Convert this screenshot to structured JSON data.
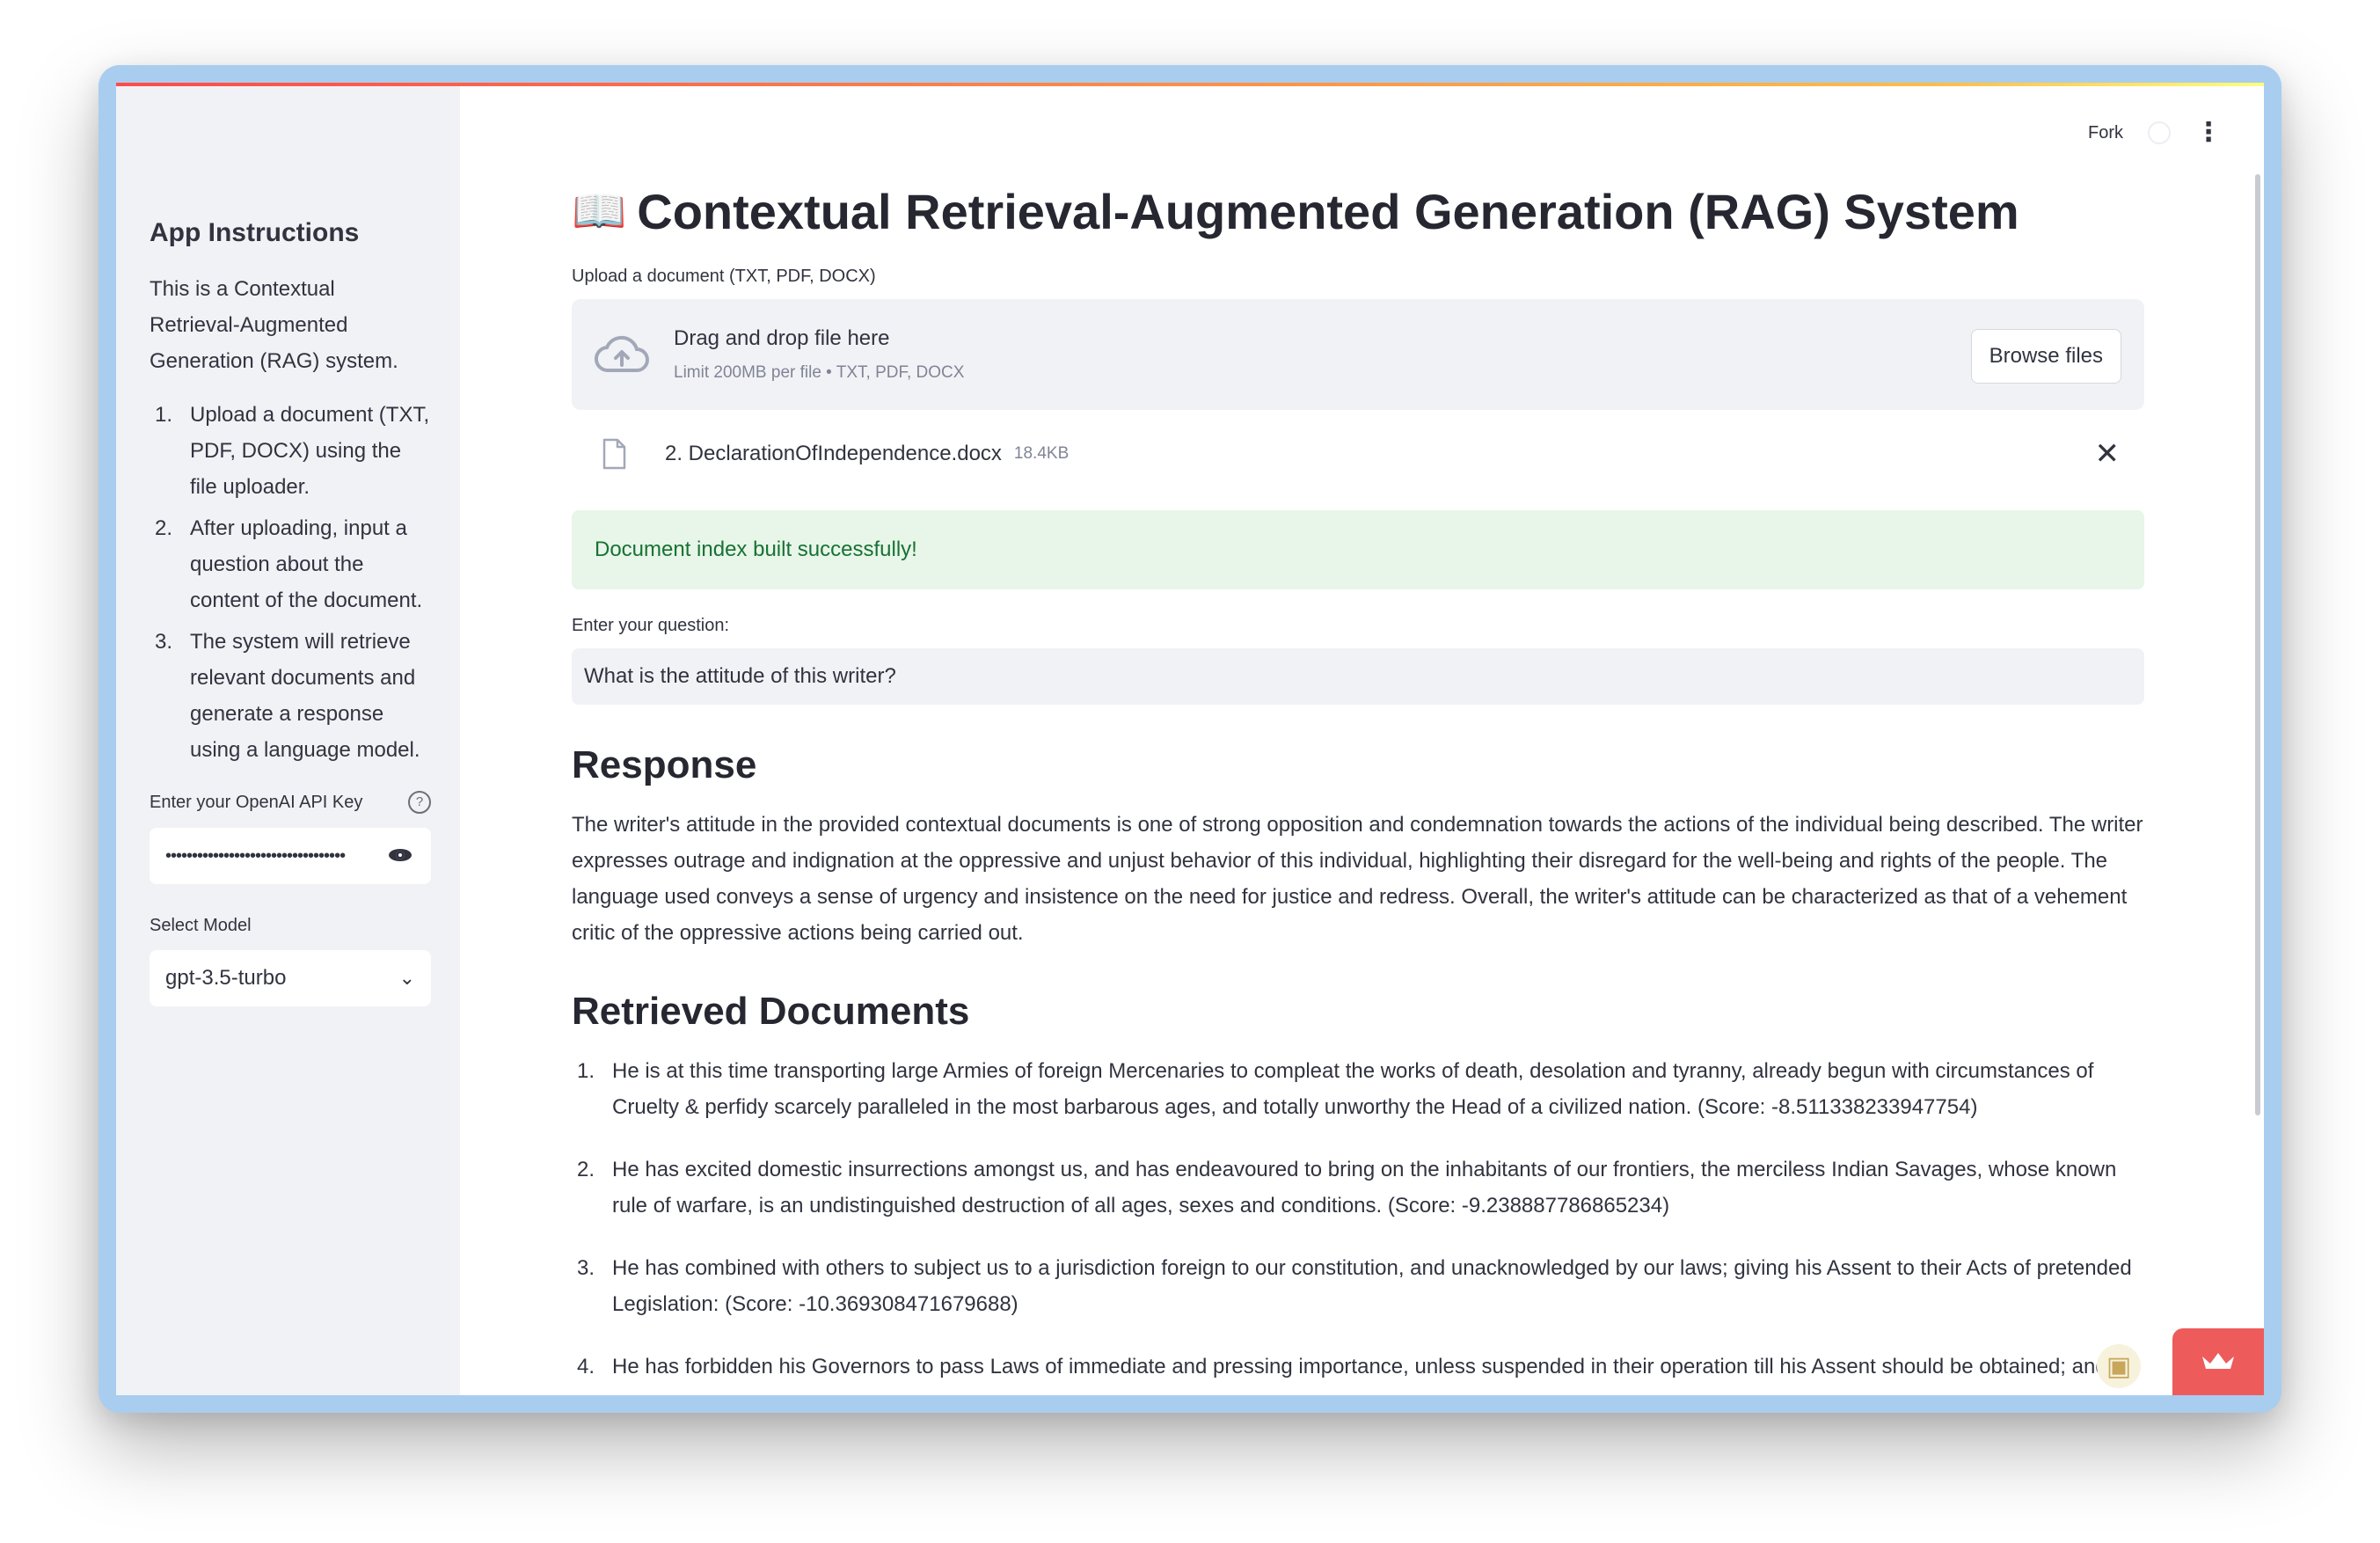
{
  "sidebar": {
    "title": "App Instructions",
    "intro": "This is a Contextual Retrieval-Augmented Generation (RAG) system.",
    "steps": [
      {
        "num": "1.",
        "text": "Upload a document (TXT, PDF, DOCX) using the file uploader."
      },
      {
        "num": "2.",
        "text": "After uploading, input a question about the content of the document."
      },
      {
        "num": "3.",
        "text": "The system will retrieve relevant documents and generate a response using a language model."
      }
    ],
    "api_key_label": "Enter your OpenAI API Key",
    "api_key_value": "••••••••••••••••••••••••••••••••••",
    "model_label": "Select Model",
    "model_value": "gpt-3.5-turbo"
  },
  "toolbar": {
    "fork_label": "Fork"
  },
  "main": {
    "title": "Contextual Retrieval-Augmented Generation (RAG) System",
    "upload_label": "Upload a document (TXT, PDF, DOCX)",
    "dropzone_title": "Drag and drop file here",
    "dropzone_limit": "Limit 200MB per file • TXT, PDF, DOCX",
    "browse_label": "Browse files",
    "file_name": "2. DeclarationOfIndependence.docx",
    "file_size": "18.4KB",
    "success_message": "Document index built successfully!",
    "question_label": "Enter your question:",
    "question_value": "What is the attitude of this writer?",
    "response_heading": "Response",
    "response_text": "The writer's attitude in the provided contextual documents is one of strong opposition and condemnation towards the actions of the individual being described. The writer expresses outrage and indignation at the oppressive and unjust behavior of this individual, highlighting their disregard for the well-being and rights of the people. The language used conveys a sense of urgency and insistence on the need for justice and redress. Overall, the writer's attitude can be characterized as that of a vehement critic of the oppressive actions being carried out.",
    "retrieved_heading": "Retrieved Documents",
    "documents": [
      {
        "num": "1.",
        "text": "He is at this time transporting large Armies of foreign Mercenaries to compleat the works of death, desolation and tyranny, already begun with circumstances of Cruelty & perfidy scarcely paralleled in the most barbarous ages, and totally unworthy the Head of a civilized nation. (Score: -8.511338233947754)"
      },
      {
        "num": "2.",
        "text": "He has excited domestic insurrections amongst us, and has endeavoured to bring on the inhabitants of our frontiers, the merciless Indian Savages, whose known rule of warfare, is an undistinguished destruction of all ages, sexes and conditions. (Score: -9.238887786865234)"
      },
      {
        "num": "3.",
        "text": "He has combined with others to subject us to a jurisdiction foreign to our constitution, and unacknowledged by our laws; giving his Assent to their Acts of pretended Legislation: (Score: -10.369308471679688)"
      },
      {
        "num": "4.",
        "text": "He has forbidden his Governors to pass Laws of immediate and pressing importance, unless suspended in their operation till his Assent should be obtained; and"
      }
    ]
  },
  "icons": {
    "book": "open-book-icon",
    "upload": "cloud-upload-icon",
    "file": "file-icon",
    "close": "close-icon",
    "eye": "eye-icon",
    "help": "help-icon",
    "chevron": "chevron-down-icon",
    "menu": "kebab-menu-icon",
    "crown": "crown-icon"
  },
  "colors": {
    "accent": "#ff4b4b",
    "sidebar_bg": "#f0f2f6",
    "success_bg": "#e8f5e9",
    "success_text": "#177233"
  }
}
